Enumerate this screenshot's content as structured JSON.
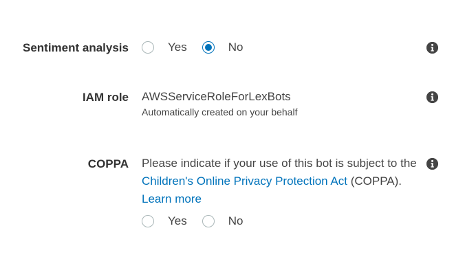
{
  "sentiment": {
    "label": "Sentiment analysis",
    "options": [
      {
        "label": "Yes",
        "selected": false
      },
      {
        "label": "No",
        "selected": true
      }
    ],
    "info_icon": "info-icon"
  },
  "iam_role": {
    "label": "IAM role",
    "value": "AWSServiceRoleForLexBots",
    "subtext": "Automatically created on your behalf",
    "info_icon": "info-icon"
  },
  "coppa": {
    "label": "COPPA",
    "text_before": "Please indicate if your use of this bot is subject to the ",
    "link_text": "Children's Online Privacy Protection Act",
    "text_after": " (COPPA). ",
    "learn_more": "Learn more",
    "options": [
      {
        "label": "Yes",
        "selected": false
      },
      {
        "label": "No",
        "selected": false
      }
    ],
    "info_icon": "info-icon"
  },
  "colors": {
    "accent": "#0073bb",
    "text": "#444444",
    "label": "#333333"
  }
}
